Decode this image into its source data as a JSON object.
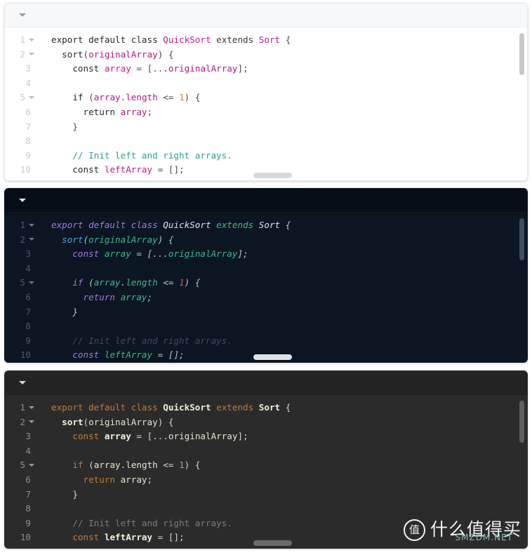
{
  "page": {
    "title": "Code syntax highlighting theme comparison",
    "panel_count": 3
  },
  "panels": [
    {
      "id": "panel-light",
      "theme_name": "light",
      "background": "#ffffff",
      "header_background": "#f7f8f9",
      "collapse_icon": "chevron-down-icon",
      "scrollbar": {
        "vertical_visible": true,
        "horizontal_visible": true
      }
    },
    {
      "id": "panel-dark-navy",
      "theme_name": "dark-navy-italic",
      "background": "#0b1622",
      "header_background": "#060d15",
      "collapse_icon": "chevron-down-icon",
      "scrollbar": {
        "vertical_visible": true,
        "horizontal_visible": true
      }
    },
    {
      "id": "panel-dark-gray",
      "theme_name": "dark-gray",
      "background": "#2b2b2b",
      "header_background": "#232323",
      "collapse_icon": "chevron-down-icon",
      "scrollbar": {
        "vertical_visible": true,
        "horizontal_visible": true
      }
    }
  ],
  "code": {
    "language": "javascript",
    "file_hint": "QuickSort",
    "lines": [
      {
        "n": "1",
        "fold": true,
        "tokens": [
          {
            "t": "export",
            "c": "kw"
          },
          {
            "t": " ",
            "c": "plain"
          },
          {
            "t": "default",
            "c": "kw"
          },
          {
            "t": " ",
            "c": "plain"
          },
          {
            "t": "class",
            "c": "kw"
          },
          {
            "t": " ",
            "c": "plain"
          },
          {
            "t": "QuickSort",
            "c": "cls"
          },
          {
            "t": " ",
            "c": "plain"
          },
          {
            "t": "extends",
            "c": "ext"
          },
          {
            "t": " ",
            "c": "plain"
          },
          {
            "t": "Sort",
            "c": "cls2"
          },
          {
            "t": " ",
            "c": "plain"
          },
          {
            "t": "{",
            "c": "punc"
          }
        ]
      },
      {
        "n": "2",
        "fold": true,
        "tokens": [
          {
            "t": "  ",
            "c": "plain"
          },
          {
            "t": "sort",
            "c": "fn"
          },
          {
            "t": "(",
            "c": "punc"
          },
          {
            "t": "originalArray",
            "c": "param"
          },
          {
            "t": ")",
            "c": "punc"
          },
          {
            "t": " ",
            "c": "plain"
          },
          {
            "t": "{",
            "c": "punc"
          }
        ]
      },
      {
        "n": "3",
        "fold": false,
        "tokens": [
          {
            "t": "    ",
            "c": "plain"
          },
          {
            "t": "const",
            "c": "kw"
          },
          {
            "t": " ",
            "c": "plain"
          },
          {
            "t": "array",
            "c": "var"
          },
          {
            "t": " ",
            "c": "plain"
          },
          {
            "t": "=",
            "c": "punc"
          },
          {
            "t": " ",
            "c": "plain"
          },
          {
            "t": "[...",
            "c": "punc"
          },
          {
            "t": "originalArray",
            "c": "param"
          },
          {
            "t": "];",
            "c": "punc"
          }
        ]
      },
      {
        "n": "4",
        "fold": false,
        "tokens": []
      },
      {
        "n": "5",
        "fold": true,
        "tokens": [
          {
            "t": "    ",
            "c": "plain"
          },
          {
            "t": "if",
            "c": "kw"
          },
          {
            "t": " ",
            "c": "plain"
          },
          {
            "t": "(",
            "c": "punc"
          },
          {
            "t": "array",
            "c": "param"
          },
          {
            "t": ".",
            "c": "punc"
          },
          {
            "t": "length",
            "c": "param"
          },
          {
            "t": " ",
            "c": "plain"
          },
          {
            "t": "<=",
            "c": "punc"
          },
          {
            "t": " ",
            "c": "plain"
          },
          {
            "t": "1",
            "c": "num"
          },
          {
            "t": ")",
            "c": "punc"
          },
          {
            "t": " ",
            "c": "plain"
          },
          {
            "t": "{",
            "c": "punc"
          }
        ]
      },
      {
        "n": "6",
        "fold": false,
        "tokens": [
          {
            "t": "      ",
            "c": "plain"
          },
          {
            "t": "return",
            "c": "kw"
          },
          {
            "t": " ",
            "c": "plain"
          },
          {
            "t": "array",
            "c": "param"
          },
          {
            "t": ";",
            "c": "punc"
          }
        ]
      },
      {
        "n": "7",
        "fold": false,
        "tokens": [
          {
            "t": "    ",
            "c": "plain"
          },
          {
            "t": "}",
            "c": "punc"
          }
        ]
      },
      {
        "n": "8",
        "fold": false,
        "tokens": []
      },
      {
        "n": "9",
        "fold": false,
        "tokens": [
          {
            "t": "    ",
            "c": "plain"
          },
          {
            "t": "// Init left and right arrays.",
            "c": "cmt"
          }
        ]
      },
      {
        "n": "10",
        "fold": false,
        "tokens": [
          {
            "t": "    ",
            "c": "plain"
          },
          {
            "t": "const",
            "c": "kw"
          },
          {
            "t": " ",
            "c": "plain"
          },
          {
            "t": "leftArray",
            "c": "var"
          },
          {
            "t": " ",
            "c": "plain"
          },
          {
            "t": "=",
            "c": "punc"
          },
          {
            "t": " ",
            "c": "plain"
          },
          {
            "t": "[];",
            "c": "punc"
          }
        ]
      }
    ]
  },
  "watermark": {
    "badge_glyph": "值",
    "text": "什么值得买",
    "subtext": "SMZDM.NET"
  }
}
